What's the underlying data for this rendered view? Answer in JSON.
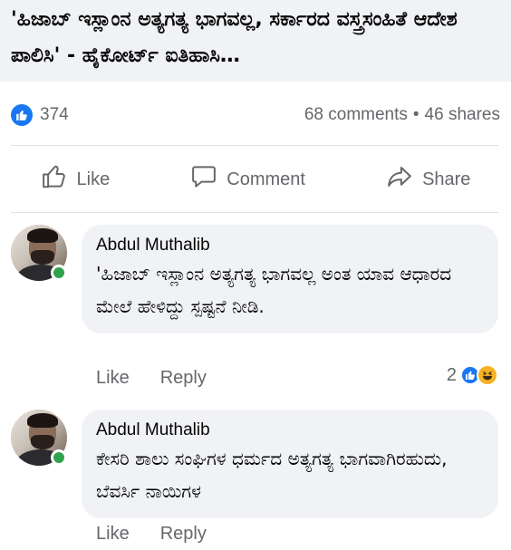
{
  "post": {
    "title": "'ಹಿಜಾಬ್ ಇಸ್ಲಾಂನ ಅತ್ಯಗತ್ಯ ಭಾಗವಲ್ಲ, ಸರ್ಕಾರದ ವಸ್ತ್ರಸಂಹಿತೆ ಆದೇಶ ಪಾಲಿಸಿ' - ಹೈಕೋರ್ಟ್ ಐತಿಹಾಸಿ…"
  },
  "stats": {
    "likes": "374",
    "comments": "68 comments",
    "separator": "•",
    "shares": "46 shares"
  },
  "actions": {
    "like": "Like",
    "comment": "Comment",
    "share": "Share"
  },
  "comments": [
    {
      "author": "Abdul Muthalib",
      "text": "'ಹಿಜಾಬ್ ಇಸ್ಲಾಂನ ಅತ್ಯಗತ್ಯ ಭಾಗವಲ್ಲ ಅಂತ ಯಾವ ಆಧಾರದ ಮೇಲೆ ಹೇಳಿದ್ದು ಸ್ಪಷ್ಟನೆ ನೀಡಿ.",
      "like_label": "Like",
      "reply_label": "Reply",
      "reaction_count": "2"
    },
    {
      "author": "Abdul Muthalib",
      "text": "ಕೇಸರಿ ಶಾಲು ಸಂಘಿಗಳ ಧರ್ಮದ ಅತ್ಯಗತ್ಯ ಭಾಗವಾಗಿರಹುದು, ಬೆವರ್ಸಿ ನಾಯಿಗಳ",
      "like_label": "Like",
      "reply_label": "Reply"
    }
  ],
  "colors": {
    "brand_blue": "#1877f2",
    "online_green": "#31a24c",
    "muted_text": "#65676b",
    "bubble_bg": "#f0f2f5"
  },
  "icons": [
    "like-thumb-icon",
    "comment-bubble-icon",
    "share-arrow-icon",
    "online-status-icon",
    "haha-emoji-icon"
  ]
}
